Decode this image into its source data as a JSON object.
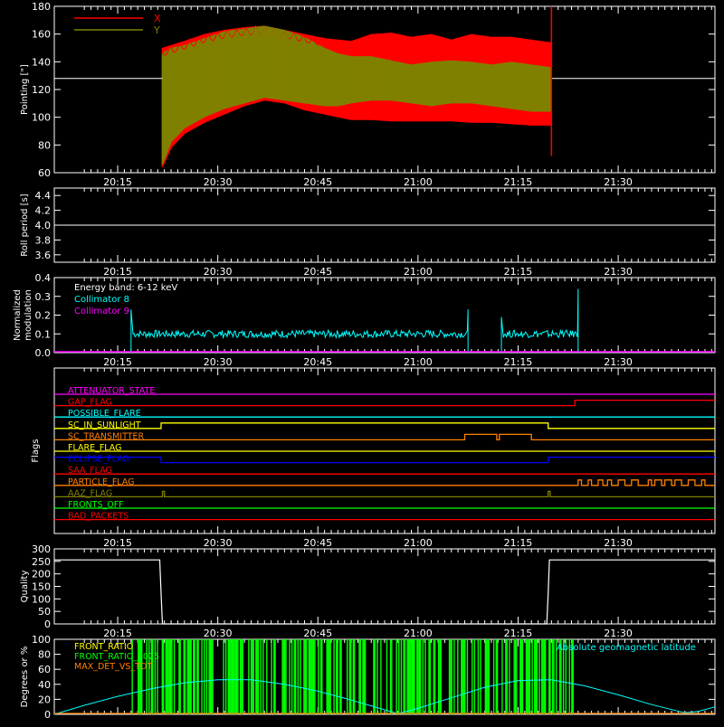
{
  "time_axis": {
    "ticks": [
      "20:15",
      "20:30",
      "20:45",
      "21:00",
      "21:15",
      "21:30"
    ],
    "tick_minutes_from_20h": [
      15,
      30,
      45,
      60,
      75,
      90
    ],
    "range_minutes_from_20h": [
      5.5,
      104.5
    ]
  },
  "chart_data": [
    {
      "id": "pointing",
      "type": "area",
      "ylabel": "Pointing [\"]",
      "ylim": [
        60,
        180
      ],
      "yticks": [
        60,
        80,
        100,
        120,
        140,
        160,
        180
      ],
      "legend": [
        {
          "label": "X",
          "color": "#ff0000"
        },
        {
          "label": "Y",
          "color": "#808000"
        }
      ],
      "legend_placement": "top-left",
      "reference_line": 128,
      "series": [
        {
          "name": "X",
          "color": "#ff0000",
          "x": [
            21.7,
            23,
            25,
            28,
            31,
            34,
            37,
            40,
            43,
            46,
            48,
            50,
            53,
            56,
            59,
            62,
            65,
            68,
            71,
            74,
            77,
            80
          ],
          "upper": [
            150,
            152,
            155,
            160,
            163,
            165,
            166,
            163,
            160,
            157,
            156,
            155,
            160,
            161,
            158,
            160,
            156,
            160,
            158,
            158,
            156,
            154
          ],
          "lower": [
            64,
            78,
            88,
            96,
            102,
            108,
            112,
            110,
            105,
            102,
            100,
            98,
            98,
            97,
            97,
            97,
            97,
            96,
            96,
            95,
            94,
            94
          ]
        },
        {
          "name": "Y",
          "color": "#808000",
          "x": [
            21.7,
            23,
            25,
            28,
            31,
            34,
            37,
            40,
            43,
            46,
            48,
            50,
            53,
            56,
            59,
            62,
            65,
            68,
            71,
            74,
            77,
            80
          ],
          "upper": [
            146,
            150,
            152,
            157,
            162,
            164,
            166,
            163,
            158,
            150,
            146,
            144,
            144,
            141,
            138,
            140,
            141,
            140,
            138,
            140,
            138,
            136
          ],
          "lower": [
            66,
            82,
            92,
            100,
            106,
            110,
            114,
            112,
            110,
            108,
            108,
            110,
            112,
            112,
            110,
            108,
            110,
            110,
            108,
            106,
            104,
            104
          ]
        }
      ]
    },
    {
      "id": "roll",
      "type": "line",
      "ylabel": "Roll period [s]",
      "ylim": [
        3.5,
        4.5
      ],
      "yticks": [
        3.6,
        3.8,
        4.0,
        4.2,
        4.4
      ],
      "series": [
        {
          "name": "",
          "color": "#ffffff",
          "x": [
            5.5,
            104.5
          ],
          "y": [
            4.0,
            4.0
          ]
        }
      ]
    },
    {
      "id": "modulation",
      "type": "line",
      "ylabel": "Normalized modulation",
      "ylim": [
        0,
        0.4
      ],
      "yticks": [
        0.0,
        0.1,
        0.2,
        0.3,
        0.4
      ],
      "legend": [
        {
          "label": "Energy band: 6-12 keV",
          "color": "#ffffff"
        },
        {
          "label": "Collimator 8",
          "color": "#00ffff"
        },
        {
          "label": "Collimator 9",
          "color": "#ff00ff"
        }
      ],
      "legend_placement": "top-left",
      "series": [
        {
          "name": "Collimator 8",
          "color": "#00ffff",
          "segments": [
            {
              "x": [
                17,
                67.5
              ],
              "level": 0.1,
              "spike_start": 0.23,
              "spike_end": 0.23
            },
            {
              "x": [
                72.5,
                84
              ],
              "level": 0.1,
              "spike_start": 0.19,
              "spike_end": 0.34
            }
          ]
        },
        {
          "name": "Collimator 9",
          "color": "#ff00ff",
          "x": [
            5.5,
            104.5
          ],
          "y": [
            0,
            0
          ]
        }
      ]
    },
    {
      "id": "flags",
      "type": "line",
      "ylabel": "Flags",
      "series": [
        {
          "name": "ATTENUATOR_STATE",
          "color": "#ff00ff",
          "x": [
            5.5,
            104.5
          ],
          "y": [
            0,
            0
          ]
        },
        {
          "name": "SAA_FLAG_TOP",
          "color": "#ff0000",
          "x": [
            5.5,
            83.5,
            83.5,
            104.5
          ],
          "y": [
            0,
            0,
            1,
            1
          ]
        },
        {
          "name": "POSSIBLE_FLARE",
          "color": "#00ffff",
          "x": [
            5.5,
            104.5
          ],
          "y": [
            0,
            0
          ]
        },
        {
          "name": "SC_IN_SUNLIGHT",
          "color": "#ffff00",
          "x": [
            5.5,
            21.5,
            21.5,
            79.5,
            79.5,
            104.5
          ],
          "y": [
            0,
            0,
            1,
            1,
            0,
            0
          ]
        },
        {
          "name": "SC_TRANSMITTER",
          "color": "#ff8000",
          "x": [
            5.5,
            67,
            67,
            71.8,
            71.8,
            72.2,
            72.2,
            77,
            77,
            104.5
          ],
          "y": [
            0,
            0,
            1,
            1,
            0,
            0,
            1,
            1,
            0,
            0
          ]
        },
        {
          "name": "FLARE_FLAG",
          "color": "#ffff00",
          "x": [
            5.5,
            104.5
          ],
          "y": [
            0,
            0
          ]
        },
        {
          "name": "ECLIPSE_FLAG",
          "color": "#0000ff",
          "x": [
            5.5,
            21.5,
            21.5,
            79.5,
            79.5,
            104.5
          ],
          "y": [
            1,
            1,
            0,
            0,
            1,
            1
          ]
        },
        {
          "name": "SAA_FLAG",
          "color": "#ff0000",
          "x": [
            5.5,
            104.5
          ],
          "y": [
            0,
            0
          ]
        },
        {
          "name": "PARTICLE_FLAG",
          "color": "#ff8000",
          "x": [
            5.5,
            84,
            84,
            84.5,
            84.5,
            85.5,
            85.5,
            86,
            86,
            87,
            87,
            87.7,
            87.7,
            88.4,
            88.4,
            89,
            89,
            90,
            90,
            91,
            91,
            92,
            92,
            93,
            93,
            94.5,
            94.5,
            95,
            95,
            95.5,
            95.5,
            96.5,
            96.5,
            97,
            97,
            98,
            98,
            98.5,
            98.5,
            99.5,
            99.5,
            100.5,
            100.5,
            101.5,
            101.5,
            102.5,
            102.5,
            103,
            103,
            104.5
          ],
          "y": [
            0,
            0,
            1,
            1,
            0,
            0,
            1,
            1,
            0,
            0,
            1,
            1,
            0,
            0,
            1,
            1,
            0,
            0,
            1,
            1,
            0,
            0,
            1,
            1,
            0,
            0,
            1,
            1,
            0,
            0,
            1,
            1,
            0,
            0,
            1,
            1,
            0,
            0,
            1,
            1,
            0,
            0,
            1,
            1,
            0,
            0,
            1,
            1,
            0,
            0
          ]
        },
        {
          "name": "AAZ_FLAG",
          "color": "#808000",
          "x": [
            5.5,
            21.7,
            21.7,
            22,
            22,
            79.5,
            79.5,
            79.8,
            79.8,
            104.5
          ],
          "y": [
            0,
            0,
            1,
            1,
            0,
            0,
            1,
            1,
            0,
            0
          ]
        },
        {
          "name": "FRONTS_OFF",
          "color": "#00ff00",
          "x": [
            5.5,
            104.5
          ],
          "y": [
            0,
            0
          ]
        },
        {
          "name": "BAD_PACKETS",
          "color": "#ff0000",
          "x": [
            5.5,
            104.5
          ],
          "y": [
            0,
            0
          ]
        }
      ],
      "labels": [
        {
          "text": "ATTENUATOR_STATE",
          "color": "#ff00ff"
        },
        {
          "text": "GAP_FLAG",
          "color": "#ff0000"
        },
        {
          "text": "POSSIBLE_FLARE",
          "color": "#00ffff"
        },
        {
          "text": "SC_IN_SUNLIGHT",
          "color": "#ffff00"
        },
        {
          "text": "SC_TRANSMITTER",
          "color": "#ff8000"
        },
        {
          "text": "FLARE_FLAG",
          "color": "#ffff00"
        },
        {
          "text": "ECLIPSE_FLAG",
          "color": "#0000ff"
        },
        {
          "text": "SAA_FLAG",
          "color": "#ff0000"
        },
        {
          "text": "PARTICLE_FLAG",
          "color": "#ff8000"
        },
        {
          "text": "AAZ_FLAG",
          "color": "#808000"
        },
        {
          "text": "FRONTS_OFF",
          "color": "#00ff00"
        },
        {
          "text": "BAD_PACKETS",
          "color": "#ff0000"
        }
      ]
    },
    {
      "id": "quality",
      "type": "line",
      "ylabel": "Quality",
      "ylim": [
        0,
        300
      ],
      "yticks": [
        0,
        50,
        100,
        150,
        200,
        250,
        300
      ],
      "series": [
        {
          "name": "",
          "color": "#ffffff",
          "x": [
            5.5,
            21.3,
            21.5,
            21.7,
            79.3,
            79.5,
            79.7,
            104.5
          ],
          "y": [
            256,
            256,
            120,
            0,
            0,
            120,
            256,
            256
          ]
        }
      ]
    },
    {
      "id": "ratios",
      "type": "line",
      "ylabel": "Degrees or %",
      "ylim": [
        0,
        100
      ],
      "yticks": [
        0,
        20,
        40,
        60,
        80,
        100
      ],
      "legend": [
        {
          "label": "FRONT_RATIO",
          "color": "#ffff00"
        },
        {
          "label": "FRONT_RATIO_1025",
          "color": "#00ff00"
        },
        {
          "label": "MAX_DET_VS_TOT",
          "color": "#ff8000"
        },
        {
          "label": "Absolute geomagnetic latitude",
          "color": "#00ffff"
        }
      ],
      "series": [
        {
          "name": "FRONT_RATIO_1025",
          "color": "#00ff00",
          "x": [
            17,
            83.5
          ],
          "y": [
            0,
            100
          ]
        },
        {
          "name": "Absolute geomagnetic latitude",
          "color": "#00ffff",
          "x": [
            5.5,
            10,
            15,
            20,
            25,
            30,
            35,
            40,
            45,
            50,
            55,
            57,
            60,
            65,
            70,
            75,
            80,
            85,
            90,
            95,
            100,
            102,
            104.5
          ],
          "y": [
            0,
            12,
            24,
            34,
            42,
            46,
            46,
            40,
            31,
            19,
            6,
            1,
            8,
            22,
            36,
            45,
            46,
            38,
            26,
            13,
            2,
            4,
            10
          ]
        }
      ]
    }
  ]
}
